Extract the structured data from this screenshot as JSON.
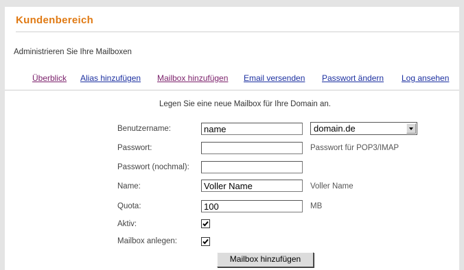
{
  "header": {
    "title": "Kundenbereich"
  },
  "subtitle": "Administrieren Sie Ihre Mailboxen",
  "nav": [
    {
      "label": "Überblick"
    },
    {
      "label": "Alias hinzufügen"
    },
    {
      "label": "Mailbox hinzufügen"
    },
    {
      "label": "Email versenden"
    },
    {
      "label": "Passwort ändern"
    },
    {
      "label": "Log ansehen"
    }
  ],
  "form": {
    "intro": "Legen Sie eine neue Mailbox für Ihre Domain an.",
    "username": {
      "label": "Benutzername:",
      "value": "name"
    },
    "domain": {
      "selected": "domain.de"
    },
    "password": {
      "label": "Passwort:",
      "value": "",
      "hint": "Passwort für POP3/IMAP"
    },
    "password_repeat": {
      "label": "Passwort (nochmal):",
      "value": ""
    },
    "name": {
      "label": "Name:",
      "value": "Voller Name",
      "hint": "Voller Name"
    },
    "quota": {
      "label": "Quota:",
      "value": "100",
      "hint": "MB"
    },
    "active": {
      "label": "Aktiv:",
      "checked": true
    },
    "create_mailbox": {
      "label": "Mailbox anlegen:",
      "checked": true
    },
    "submit_label": "Mailbox hinzufügen"
  },
  "colors": {
    "title": "#e07a14",
    "link_visited": "#7a1f6a",
    "link": "#1b2fa0"
  }
}
